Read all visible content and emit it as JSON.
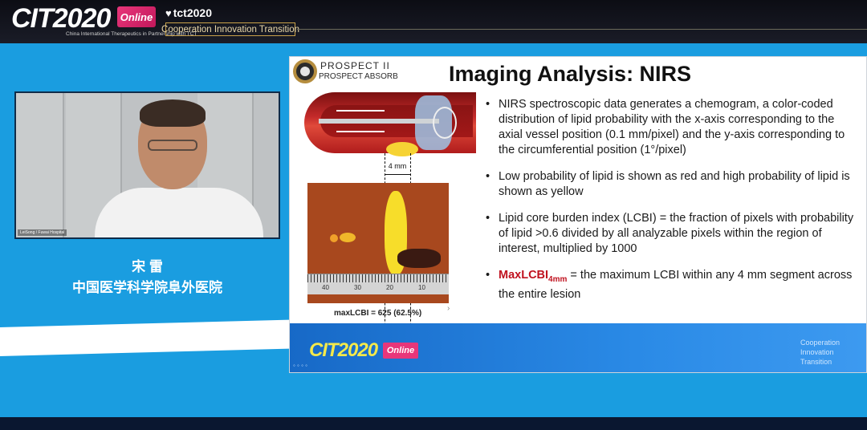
{
  "banner": {
    "logo": "CIT2020",
    "logo_sub": "China International Therapeutics in Partnership with TCT",
    "online_badge": "Online",
    "partner_small": "IN PARTNERSHIP WITH",
    "tct": "tct2020",
    "tagline": "Cooperation Innovation Transition"
  },
  "speaker": {
    "video_label": "LeiSong / Fuwai Hospital",
    "name": "宋 雷",
    "institution": "中国医学科学院阜外医院"
  },
  "slide": {
    "logo_title": "PROSPECT II",
    "logo_subtitle": "PROSPECT ABSORB",
    "title": "Imaging Analysis: NIRS",
    "mm_label": "4 mm",
    "ruler_numbers": [
      "40",
      "30",
      "20",
      "10"
    ],
    "caption": "maxLCBI = 625 (62.5%)",
    "bullets": [
      "NIRS spectroscopic data generates a chemogram, a color-coded distribution of lipid probability with the x-axis corresponding to the axial vessel position (0.1 mm/pixel) and the y-axis corresponding to the circumferential position (1°/pixel)",
      "Low probability of lipid is shown as red and high probability of lipid is shown as yellow",
      "Lipid core burden index (LCBI) = the fraction of pixels with probability of lipid >0.6 divided by all analyzable pixels within the region of interest, multiplied by 1000"
    ],
    "last_bullet": {
      "term": "MaxLCBI",
      "term_sub": "4mm",
      "text": " = the maximum LCBI within any 4 mm segment across the entire lesion"
    },
    "footer_logo": "CIT2020",
    "footer_online": "Online",
    "footer_coop": [
      "Cooperation",
      "Innovation",
      "Transition"
    ],
    "nav": "◦ ◦ ◦ ◦"
  },
  "bottom_text": "                "
}
